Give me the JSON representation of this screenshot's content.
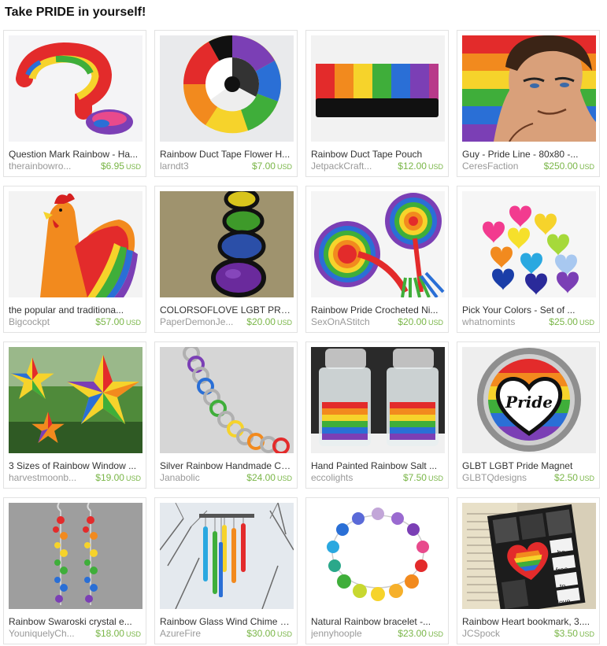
{
  "title": "Take PRIDE in yourself!",
  "items": [
    {
      "name": "Question Mark Rainbow - Ha...",
      "shop": "therainbowro...",
      "price": "$6.95",
      "currency": "USD",
      "image": "rainbow-question-mark-image"
    },
    {
      "name": "Rainbow Duct Tape Flower H...",
      "shop": "larndt3",
      "price": "$7.00",
      "currency": "USD",
      "image": "duct-tape-flower-image"
    },
    {
      "name": "Rainbow Duct Tape Pouch",
      "shop": "JetpackCraft...",
      "price": "$12.00",
      "currency": "USD",
      "image": "duct-tape-pouch-image"
    },
    {
      "name": "Guy - Pride Line - 80x80 -...",
      "shop": "CeresFaction",
      "price": "$250.00",
      "currency": "USD",
      "image": "illustrated-guy-image"
    },
    {
      "name": "the popular and traditiona...",
      "shop": "Bigcockpt",
      "price": "$57.00",
      "currency": "USD",
      "image": "rainbow-rooster-image"
    },
    {
      "name": "COLORSOFLOVE LGBT PRIDE",
      "shop": "PaperDemonJe...",
      "price": "$20.00",
      "currency": "USD",
      "image": "glass-circles-image"
    },
    {
      "name": "Rainbow Pride Crocheted Ni...",
      "shop": "SexOnAStitch",
      "price": "$20.00",
      "currency": "USD",
      "image": "crochet-image"
    },
    {
      "name": "Pick Your Colors - Set of ...",
      "shop": "whatnomints",
      "price": "$25.00",
      "currency": "USD",
      "image": "felt-hearts-image"
    },
    {
      "name": "3 Sizes of Rainbow Window ...",
      "shop": "harvestmoonb...",
      "price": "$19.00",
      "currency": "USD",
      "image": "window-stars-image"
    },
    {
      "name": "Silver Rainbow Handmade Ch...",
      "shop": "Janabolic",
      "price": "$24.00",
      "currency": "USD",
      "image": "chainmaille-image"
    },
    {
      "name": "Hand Painted Rainbow Salt ...",
      "shop": "eccolights",
      "price": "$7.50",
      "currency": "USD",
      "image": "salt-shakers-image"
    },
    {
      "name": "GLBT LGBT Pride Magnet",
      "shop": "GLBTQdesigns",
      "price": "$2.50",
      "currency": "USD",
      "image": "pride-magnet-image",
      "magnet_text": "Pride"
    },
    {
      "name": "Rainbow Swaroski crystal e...",
      "shop": "YouniquelyCh...",
      "price": "$18.00",
      "currency": "USD",
      "image": "crystal-earrings-image"
    },
    {
      "name": "Rainbow Glass Wind Chime w...",
      "shop": "AzureFire",
      "price": "$30.00",
      "currency": "USD",
      "image": "wind-chime-image"
    },
    {
      "name": "Natural Rainbow bracelet -...",
      "shop": "jennyhoople",
      "price": "$23.00",
      "currency": "USD",
      "image": "shell-bracelet-image"
    },
    {
      "name": "Rainbow Heart bookmark, 3....",
      "shop": "JCSpock",
      "price": "$3.50",
      "currency": "USD",
      "image": "heart-bookmark-image",
      "bookmark_words": [
        "be",
        "free",
        "to",
        "love"
      ]
    }
  ],
  "colors": {
    "price": "#7ab648",
    "shop": "#999999",
    "rainbow": [
      "#e32b2b",
      "#f28a1e",
      "#f6d32b",
      "#3fae3a",
      "#2a6fd6",
      "#7b3fb5"
    ]
  }
}
